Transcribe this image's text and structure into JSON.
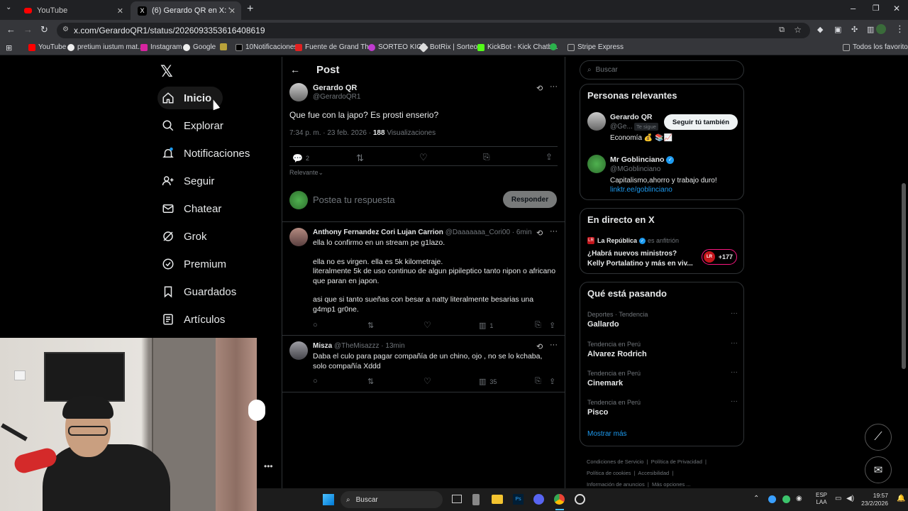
{
  "browser": {
    "tabs": [
      {
        "label": "YouTube",
        "color": "#ff0000"
      },
      {
        "label": "(6) Gerardo QR en X: \"@MGobl",
        "color": "#000000"
      }
    ],
    "url": "x.com/GerardoQR1/status/2026093353616408619",
    "bookmarks": [
      "YouTube",
      "pretium iustum mat...",
      "Instagram",
      "Google",
      "10Notificaciones",
      "Fuente de Grand Th...",
      "SORTEO KICK",
      "BotRix | Sorteos",
      "KickBot - Kick Chatb...",
      "Stripe Express"
    ],
    "all_bookmarks": "Todos los favoritos"
  },
  "nav": {
    "items": [
      "Inicio",
      "Explorar",
      "Notificaciones",
      "Seguir",
      "Chatear",
      "Grok",
      "Premium",
      "Guardados",
      "Artículos"
    ]
  },
  "post": {
    "header": "Post",
    "author_name": "Gerardo QR",
    "author_handle": "@GerardoQR1",
    "text": "Que fue con la japo? Es prosti enserio?",
    "meta_time": "7:34 p. m. · 23 feb. 2026 ·",
    "views_count": "188",
    "views_label": "Visualizaciones",
    "replies_count": "2",
    "sort_label": "Relevante",
    "reply_placeholder": "Postea tu respuesta",
    "reply_button": "Responder"
  },
  "replies": [
    {
      "name": "Anthony Fernandez Cori Lujan Carrion",
      "handle": "@Daaaaaaa_Cori00 · 6min",
      "lines": [
        "ella lo confirmo en un stream pe g1lazo.",
        "",
        "ella no es virgen. ella es 5k kilometraje.",
        "literalmente 5k de uso continuo de algun pipileptico tanto nipon o africano que paran en japon.",
        "",
        "asi que si tanto sueñas con besar a natty literalmente besarias una g4mp1 gr0ne."
      ],
      "views": "1"
    },
    {
      "name": "Misza",
      "handle": "@TheMisazzz · 13min",
      "lines": [
        "Daba el culo para pagar compañía de un chino, ojo , no se lo kchaba, solo compañía Xddd"
      ],
      "views": "35"
    }
  ],
  "search": {
    "placeholder": "Buscar"
  },
  "relevant": {
    "title": "Personas relevantes",
    "people": [
      {
        "name": "Gerardo QR",
        "handle": "@Ge...",
        "badge": "Te sigue",
        "bio": "Economía 💰 📚📈",
        "button": "Seguir tú también"
      },
      {
        "name": "Mr Goblinciano",
        "handle": "@MGoblinciano",
        "bio": "Capitalismo,ahorro y trabajo duro!",
        "link": "linktr.ee/goblinciano"
      }
    ]
  },
  "live": {
    "title": "En directo en X",
    "source": "La República",
    "role": "es anfitrión",
    "text": "¿Habrá nuevos ministros? Kelly Portalatino y más en viv...",
    "count": "+177",
    "badge": "LR"
  },
  "trends": {
    "title": "Qué está pasando",
    "items": [
      {
        "category": "Deportes · Tendencia",
        "name": "Gallardo"
      },
      {
        "category": "Tendencia en Perú",
        "name": "Alvarez Rodrich"
      },
      {
        "category": "Tendencia en Perú",
        "name": "Cinemark"
      },
      {
        "category": "Tendencia en Perú",
        "name": "Pisco"
      }
    ],
    "more": "Mostrar más"
  },
  "footer": [
    "Condiciones de Servicio",
    "Política de Privacidad",
    "Política de cookies",
    "Accesibilidad",
    "Información de anuncios",
    "Más opciones ..."
  ],
  "taskbar": {
    "search": "Buscar",
    "lang": "ESP",
    "lang2": "LAA",
    "time": "19:57",
    "date": "23/2/2026"
  },
  "colors": {
    "accent": "#1d9bf0",
    "bg": "#000000",
    "border": "#2f3336"
  }
}
